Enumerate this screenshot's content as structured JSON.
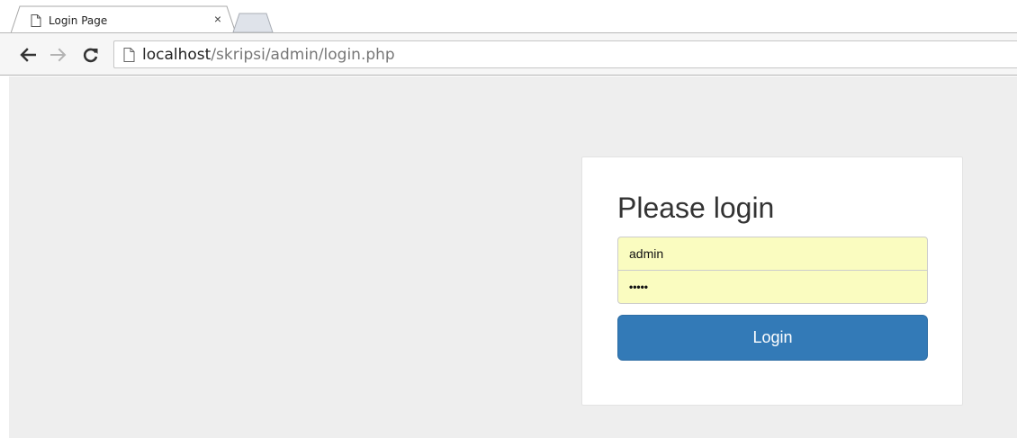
{
  "browser": {
    "tab_title": "Login Page",
    "tab_close": "×",
    "url_host": "localhost",
    "url_path": "/skripsi/admin/login.php"
  },
  "login": {
    "heading": "Please login",
    "username_value": "admin",
    "password_mask": "•••••",
    "submit_label": "Login"
  },
  "colors": {
    "page_bg": "#eeeeee",
    "autofill_bg": "#fafcc0",
    "primary_button": "#337ab7"
  }
}
